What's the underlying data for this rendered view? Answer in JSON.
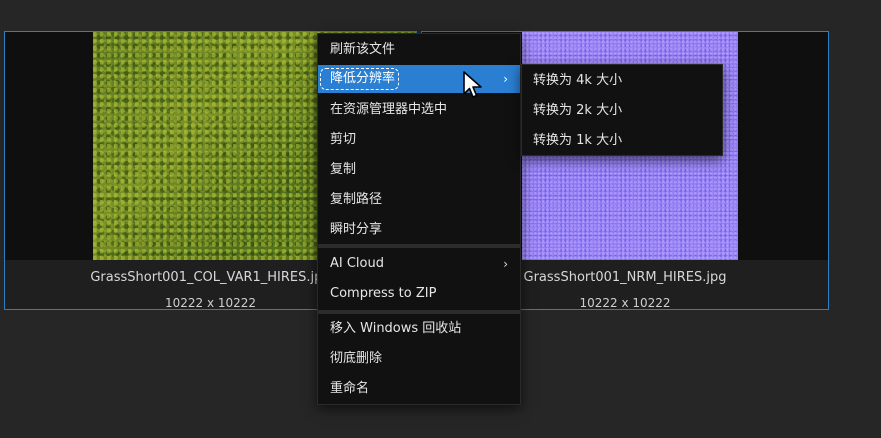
{
  "files": [
    {
      "name": "GrassShort001_COL_VAR1_HIRES.jpg",
      "dimensions": "10222 x 10222"
    },
    {
      "name": "GrassShort001_NRM_HIRES.jpg",
      "dimensions": "10222 x 10222"
    }
  ],
  "context_menu": {
    "items": [
      {
        "label": "刷新该文件"
      },
      {
        "label": "降低分辨率",
        "submenu_indicator": "›"
      },
      {
        "label": "在资源管理器中选中"
      },
      {
        "label": "剪切"
      },
      {
        "label": "复制"
      },
      {
        "label": "复制路径"
      },
      {
        "label": "瞬时分享"
      },
      {
        "label": "AI Cloud",
        "submenu_indicator": "›"
      },
      {
        "label": "Compress to ZIP"
      },
      {
        "label": "移入 Windows 回收站"
      },
      {
        "label": "彻底删除"
      },
      {
        "label": "重命名"
      }
    ]
  },
  "submenu": {
    "items": [
      {
        "label": "转换为 4k 大小"
      },
      {
        "label": "转换为 2k 大小"
      },
      {
        "label": "转换为 1k 大小"
      }
    ]
  },
  "colors": {
    "accent": "#2b7fd3",
    "selection_border": "#2d7fc4",
    "menu_bg": "#111111",
    "page_bg": "#262626"
  }
}
